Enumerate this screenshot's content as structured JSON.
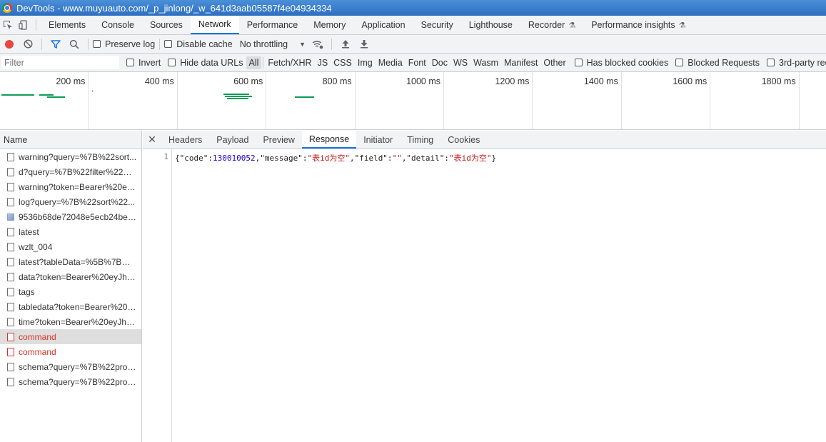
{
  "window": {
    "title": "DevTools - www.muyuauto.com/_p_jinlong/_w_641d3aab05587f4e04934334"
  },
  "panel_tabs": [
    {
      "label": "Elements"
    },
    {
      "label": "Console"
    },
    {
      "label": "Sources"
    },
    {
      "label": "Network"
    },
    {
      "label": "Performance"
    },
    {
      "label": "Memory"
    },
    {
      "label": "Application"
    },
    {
      "label": "Security"
    },
    {
      "label": "Lighthouse"
    },
    {
      "label": "Recorder"
    },
    {
      "label": "Performance insights"
    }
  ],
  "active_panel_tab": "Network",
  "toolbar": {
    "preserve_log": "Preserve log",
    "disable_cache": "Disable cache",
    "throttling": "No throttling"
  },
  "filter": {
    "placeholder": "Filter",
    "invert": "Invert",
    "hide_data_urls": "Hide data URLs",
    "types": [
      "All",
      "Fetch/XHR",
      "JS",
      "CSS",
      "Img",
      "Media",
      "Font",
      "Doc",
      "WS",
      "Wasm",
      "Manifest",
      "Other"
    ],
    "active_type": "All",
    "has_blocked_cookies": "Has blocked cookies",
    "blocked_requests": "Blocked Requests",
    "third_party": "3rd-party reque"
  },
  "overview": {
    "ticks": [
      "200 ms",
      "400 ms",
      "600 ms",
      "800 ms",
      "1000 ms",
      "1200 ms",
      "1400 ms",
      "1600 ms",
      "1800 ms"
    ]
  },
  "requests": {
    "header": "Name",
    "items": [
      {
        "name": "warning?query=%7B%22sort...",
        "icon": "doc-icon",
        "status": "ok"
      },
      {
        "name": "d?query=%7B%22filter%22%...",
        "icon": "doc-icon",
        "status": "ok"
      },
      {
        "name": "warning?token=Bearer%20eyJ...",
        "icon": "doc-icon",
        "status": "ok"
      },
      {
        "name": "log?query=%7B%22sort%22...",
        "icon": "doc-icon",
        "status": "ok"
      },
      {
        "name": "9536b68de72048e5ecb24be8...",
        "icon": "image-icon",
        "status": "ok"
      },
      {
        "name": "latest",
        "icon": "doc-icon",
        "status": "ok"
      },
      {
        "name": "wzlt_004",
        "icon": "doc-icon",
        "status": "ok"
      },
      {
        "name": "latest?tableData=%5B%7B%2...",
        "icon": "doc-icon",
        "status": "ok"
      },
      {
        "name": "data?token=Bearer%20eyJhb...",
        "icon": "doc-icon",
        "status": "ok"
      },
      {
        "name": "tags",
        "icon": "doc-icon",
        "status": "ok"
      },
      {
        "name": "tabledata?token=Bearer%20e...",
        "icon": "doc-icon",
        "status": "ok"
      },
      {
        "name": "time?token=Bearer%20eyJhb...",
        "icon": "doc-icon",
        "status": "ok"
      },
      {
        "name": "command",
        "icon": "doc-icon",
        "status": "error",
        "selected": true
      },
      {
        "name": "command",
        "icon": "doc-icon",
        "status": "error"
      },
      {
        "name": "schema?query=%7B%22proje...",
        "icon": "doc-icon",
        "status": "ok"
      },
      {
        "name": "schema?query=%7B%22proje...",
        "icon": "doc-icon",
        "status": "ok"
      }
    ]
  },
  "detail": {
    "tabs": [
      {
        "label": "Headers"
      },
      {
        "label": "Payload"
      },
      {
        "label": "Preview"
      },
      {
        "label": "Response"
      },
      {
        "label": "Initiator"
      },
      {
        "label": "Timing"
      },
      {
        "label": "Cookies"
      }
    ],
    "active_tab": "Response",
    "response": {
      "line_number": "1",
      "code": "130010052",
      "message": "表id为空",
      "field": "",
      "detail": "表id为空"
    }
  },
  "colors": {
    "accent": "#1a73e8",
    "error": "#d93025",
    "record": "#e8473f",
    "waterfall": "#0f9d58"
  }
}
